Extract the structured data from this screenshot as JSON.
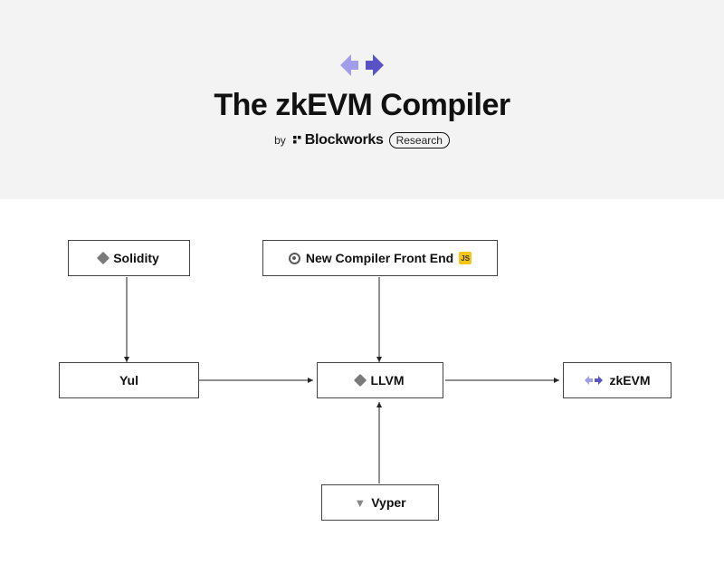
{
  "header": {
    "title": "The zkEVM Compiler",
    "by_label": "by",
    "brand": "Blockworks",
    "pill": "Research"
  },
  "nodes": {
    "solidity": "Solidity",
    "frontend": "New Compiler Front End",
    "yul": "Yul",
    "llvm": "LLVM",
    "zkevm": "zkEVM",
    "vyper": "Vyper"
  },
  "colors": {
    "arrow_light": "#9a96e8",
    "arrow_dark": "#5a53c8",
    "shield": "#f5c518",
    "border": "#444444"
  },
  "chart_data": {
    "type": "diagram",
    "title": "The zkEVM Compiler",
    "nodes": [
      "Solidity",
      "New Compiler Front End",
      "Yul",
      "LLVM",
      "Vyper",
      "zkEVM"
    ],
    "edges": [
      {
        "from": "Solidity",
        "to": "Yul"
      },
      {
        "from": "New Compiler Front End",
        "to": "LLVM"
      },
      {
        "from": "Yul",
        "to": "LLVM"
      },
      {
        "from": "Vyper",
        "to": "LLVM"
      },
      {
        "from": "LLVM",
        "to": "zkEVM"
      }
    ]
  }
}
